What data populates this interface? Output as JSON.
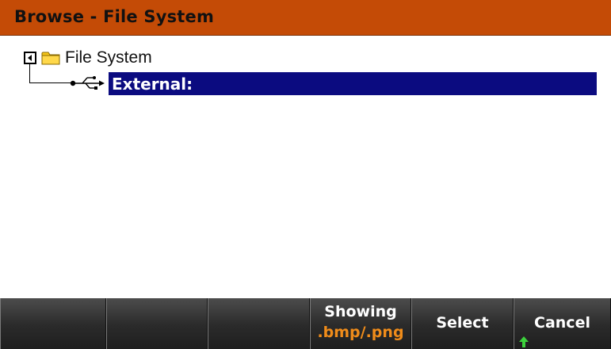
{
  "window": {
    "title": "Browse - File System"
  },
  "tree": {
    "root": {
      "label": "File System",
      "expanded": true,
      "icon": "folder-icon"
    },
    "children": [
      {
        "label": "External:",
        "icon": "usb-icon",
        "selected": true
      }
    ]
  },
  "softkeys": [
    {
      "line1": "",
      "line2": ""
    },
    {
      "line1": "",
      "line2": ""
    },
    {
      "line1": "",
      "line2": ""
    },
    {
      "line1": "Showing",
      "line2": ".bmp/.png"
    },
    {
      "line1": "Select",
      "line2": ""
    },
    {
      "line1": "Cancel",
      "line2": "",
      "indicator": "up-arrow-icon"
    }
  ],
  "colors": {
    "title_bar": "#c44b06",
    "selection": "#0b0b80",
    "softkey_value": "#f08c1a",
    "indicator": "#3cd23c"
  }
}
